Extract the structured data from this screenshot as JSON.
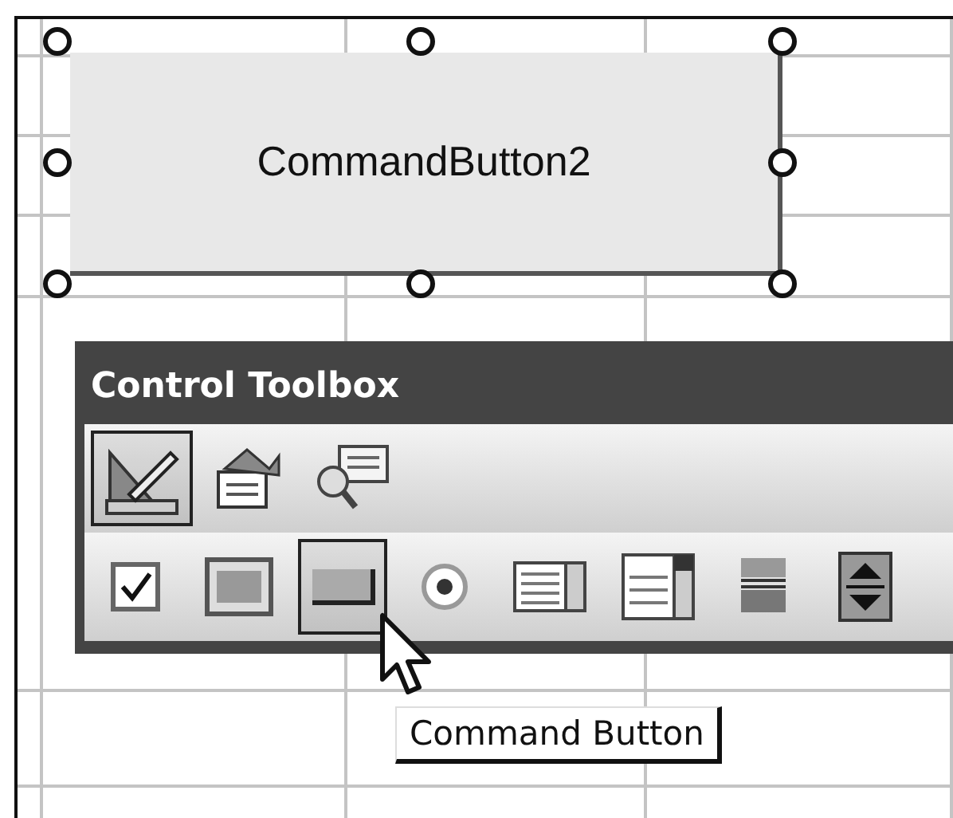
{
  "sheet_button": {
    "label": "CommandButton2",
    "selected": true
  },
  "toolbox": {
    "title": "Control Toolbox",
    "rows": [
      [
        {
          "kind": "design",
          "selected": true
        },
        {
          "kind": "properties",
          "selected": false
        },
        {
          "kind": "code",
          "selected": false
        }
      ],
      [
        {
          "kind": "checkbox",
          "selected": false
        },
        {
          "kind": "textbox",
          "selected": false
        },
        {
          "kind": "button",
          "selected": true
        },
        {
          "kind": "option",
          "selected": false
        },
        {
          "kind": "listbox",
          "selected": false
        },
        {
          "kind": "combobox",
          "selected": false
        },
        {
          "kind": "scrollbar",
          "selected": false
        },
        {
          "kind": "spin",
          "selected": false
        }
      ]
    ]
  },
  "tooltip": {
    "text": "Command Button"
  }
}
